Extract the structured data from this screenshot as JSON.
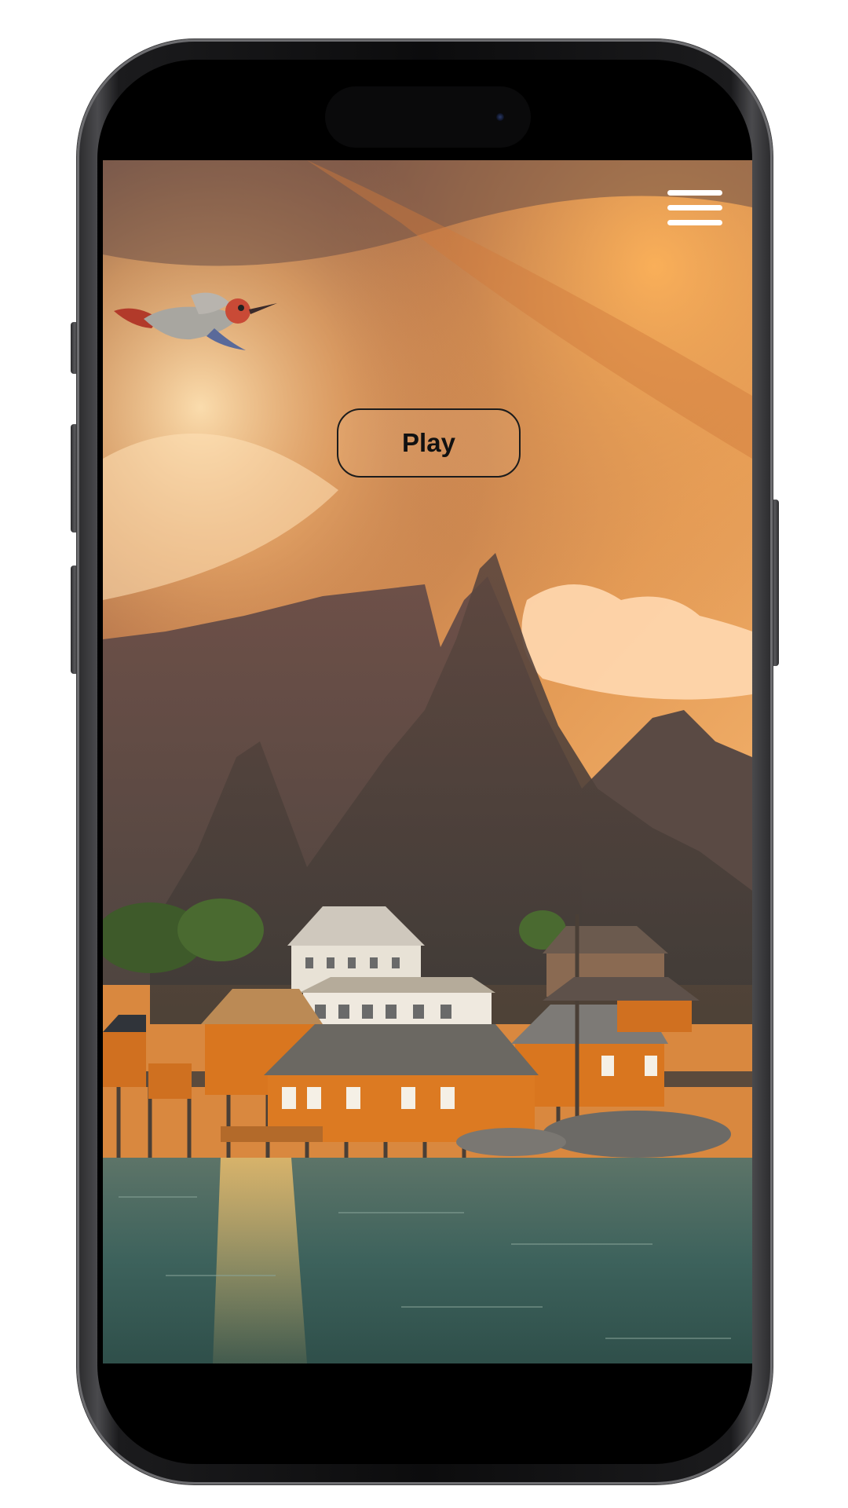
{
  "screen": {
    "menu_icon": "hamburger-menu-icon",
    "play_button": {
      "label": "Play"
    },
    "bird_icon": "hummingbird-icon"
  },
  "colors": {
    "sky_dark": "#7a5a4a",
    "sky_orange": "#e89a4a",
    "mountain": "#5e4a44",
    "house_orange": "#d9761f",
    "water": "#3f6a62",
    "frame": "#1b1b1d"
  }
}
